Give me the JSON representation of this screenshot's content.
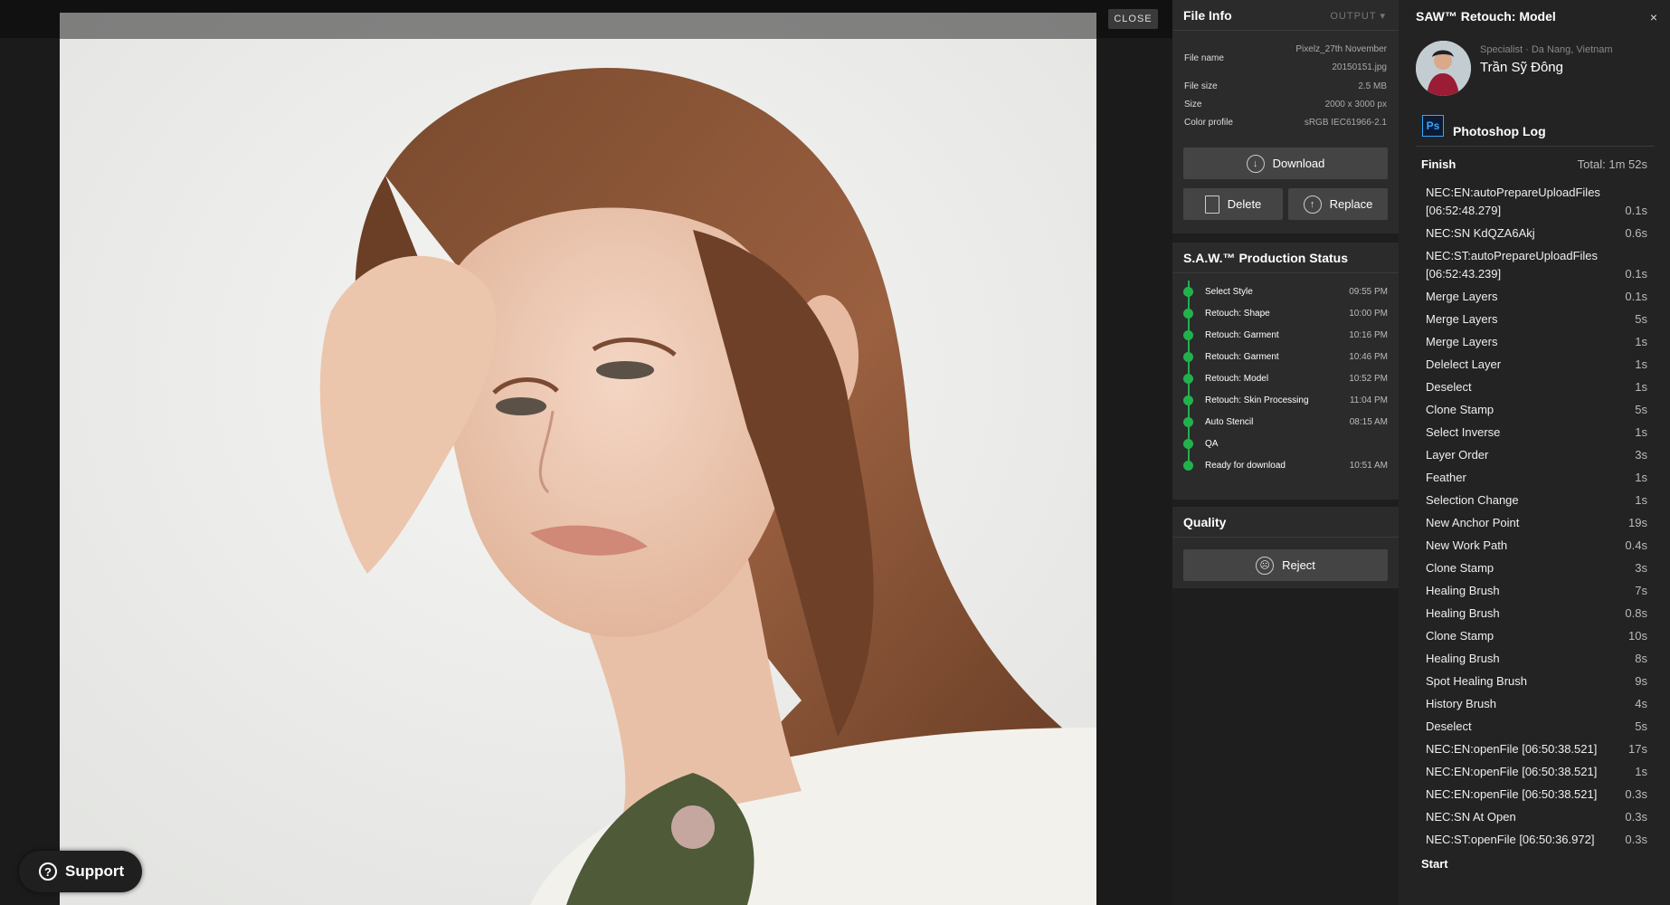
{
  "viewer": {
    "close_label": "CLOSE",
    "support_label": "Support"
  },
  "file_info": {
    "title": "File Info",
    "output_label": "OUTPUT",
    "rows": [
      {
        "label": "File name",
        "value": "Pixelz_27th November 20150151.jpg"
      },
      {
        "label": "File size",
        "value": "2.5 MB"
      },
      {
        "label": "Size",
        "value": "2000 x 3000 px"
      },
      {
        "label": "Color profile",
        "value": "sRGB IEC61966-2.1"
      }
    ],
    "download_label": "Download",
    "delete_label": "Delete",
    "replace_label": "Replace"
  },
  "production_status": {
    "title": "S.A.W.™ Production Status",
    "steps": [
      {
        "label": "Select Style",
        "time": "09:55 PM"
      },
      {
        "label": "Retouch: Shape",
        "time": "10:00 PM"
      },
      {
        "label": "Retouch: Garment",
        "time": "10:16 PM"
      },
      {
        "label": "Retouch: Garment",
        "time": "10:46 PM"
      },
      {
        "label": "Retouch: Model",
        "time": "10:52 PM"
      },
      {
        "label": "Retouch: Skin Processing",
        "time": "11:04 PM"
      },
      {
        "label": "Auto Stencil",
        "time": "08:15 AM"
      },
      {
        "label": "QA",
        "time": ""
      },
      {
        "label": "Ready for download",
        "time": "10:51 AM"
      }
    ],
    "accent_color": "#23b14d"
  },
  "quality": {
    "title": "Quality",
    "reject_label": "Reject"
  },
  "retouch_panel": {
    "title": "SAW™ Retouch: Model",
    "close_icon": "×",
    "specialist_meta": "Specialist · Da Nang, Vietnam",
    "specialist_name": "Trần Sỹ Đông",
    "log_title": "Photoshop Log",
    "ps_icon_text": "Ps",
    "finish_label": "Finish",
    "total_label": "Total: 1m 52s",
    "start_label": "Start",
    "log": [
      {
        "action": "NEC:EN:autoPrepareUploadFiles [06:52:48.279]",
        "duration": "0.1s"
      },
      {
        "action": "NEC:SN KdQZA6Akj",
        "duration": "0.6s"
      },
      {
        "action": "NEC:ST:autoPrepareUploadFiles [06:52:43.239]",
        "duration": "0.1s"
      },
      {
        "action": "Merge Layers",
        "duration": "0.1s"
      },
      {
        "action": "Merge Layers",
        "duration": "5s"
      },
      {
        "action": "Merge Layers",
        "duration": "1s"
      },
      {
        "action": "Delelect Layer",
        "duration": "1s"
      },
      {
        "action": "Deselect",
        "duration": "1s"
      },
      {
        "action": "Clone Stamp",
        "duration": "5s"
      },
      {
        "action": "Select Inverse",
        "duration": "1s"
      },
      {
        "action": "Layer Order",
        "duration": "3s"
      },
      {
        "action": "Feather",
        "duration": "1s"
      },
      {
        "action": "Selection Change",
        "duration": "1s"
      },
      {
        "action": "New Anchor Point",
        "duration": "19s"
      },
      {
        "action": "New Work Path",
        "duration": "0.4s"
      },
      {
        "action": "Clone Stamp",
        "duration": "3s"
      },
      {
        "action": "Healing Brush",
        "duration": "7s"
      },
      {
        "action": "Healing Brush",
        "duration": "0.8s"
      },
      {
        "action": "Clone Stamp",
        "duration": "10s"
      },
      {
        "action": "Healing Brush",
        "duration": "8s"
      },
      {
        "action": "Spot Healing Brush",
        "duration": "9s"
      },
      {
        "action": "History Brush",
        "duration": "4s"
      },
      {
        "action": "Deselect",
        "duration": "5s"
      },
      {
        "action": "NEC:EN:openFile [06:50:38.521]",
        "duration": "17s"
      },
      {
        "action": "NEC:EN:openFile [06:50:38.521]",
        "duration": "1s"
      },
      {
        "action": "NEC:EN:openFile [06:50:38.521]",
        "duration": "0.3s"
      },
      {
        "action": "NEC:SN At Open",
        "duration": "0.3s"
      },
      {
        "action": "NEC:ST:openFile [06:50:36.972]",
        "duration": "0.3s"
      }
    ]
  }
}
